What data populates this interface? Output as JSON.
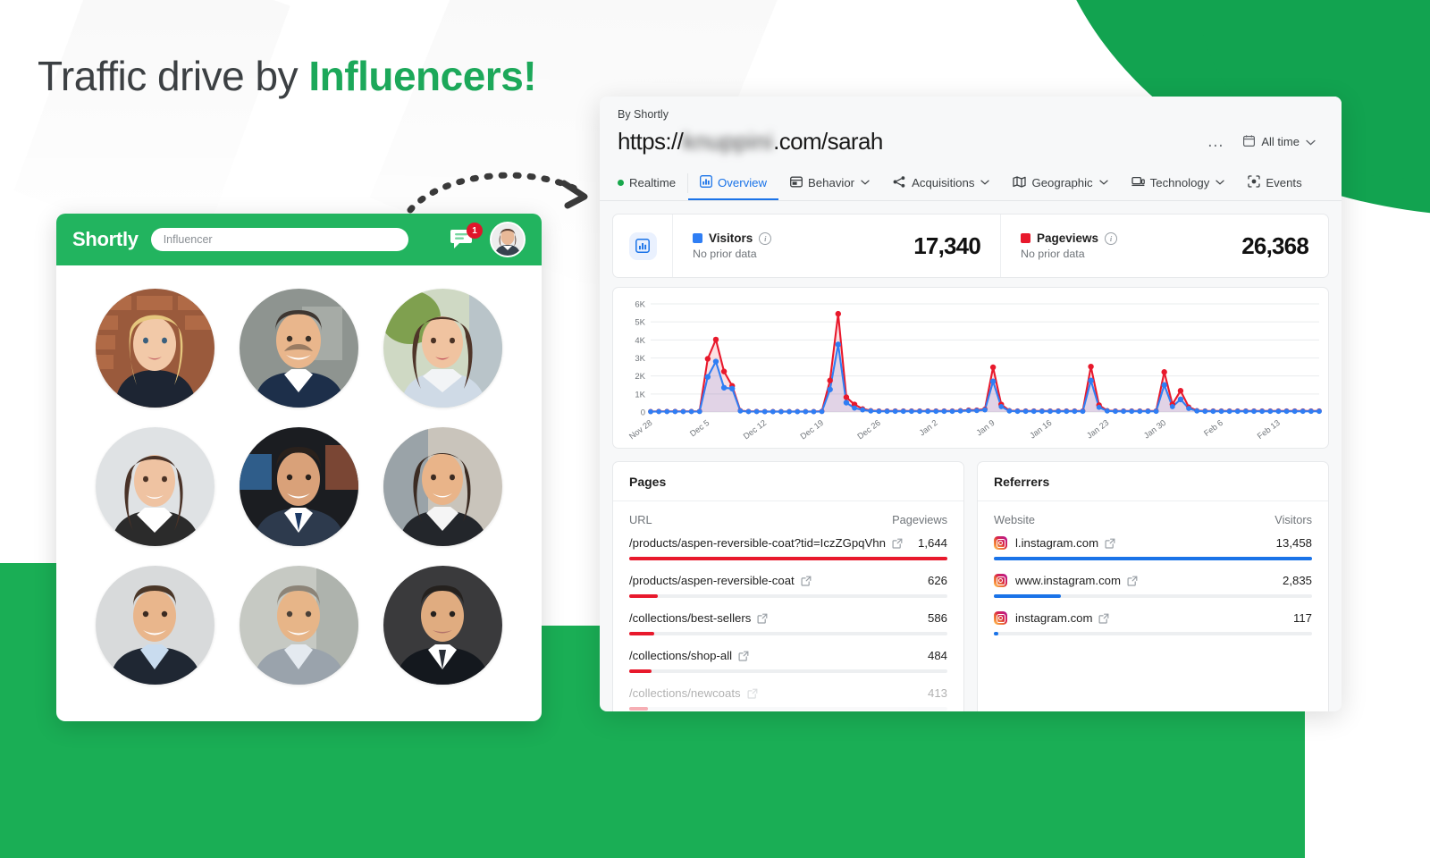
{
  "headline": {
    "text_plain": "Traffic drive by ",
    "text_accent": "Influencers!"
  },
  "colors": {
    "brand_green": "#1CA85A",
    "app_bar_green": "#22B45F",
    "visitors_blue": "#2F7EF4",
    "pageviews_red": "#E8192C",
    "active_tab_blue": "#1A73E8"
  },
  "app": {
    "logo": "Shortly",
    "search_value": "Influencer",
    "search_placeholder": "Influencer",
    "chat_badge": "1",
    "icons": {
      "chat": "chat-icon",
      "avatar": "avatar"
    },
    "influencer_count": 9
  },
  "analytics": {
    "owner_label": "By Shortly",
    "url_prefix": "https://",
    "url_domain_blurred": "knuppini",
    "url_suffix": ".com/sarah",
    "more_menu": "…",
    "date_range": "All time",
    "tabs": [
      {
        "label": "Realtime",
        "icon": "live-dot-icon",
        "active": false,
        "caret": false
      },
      {
        "label": "Overview",
        "icon": "bar-chart-icon",
        "active": true,
        "caret": false
      },
      {
        "label": "Behavior",
        "icon": "window-icon",
        "active": false,
        "caret": true
      },
      {
        "label": "Acquisitions",
        "icon": "branch-icon",
        "active": false,
        "caret": true
      },
      {
        "label": "Geographic",
        "icon": "map-icon",
        "active": false,
        "caret": true
      },
      {
        "label": "Technology",
        "icon": "laptop-icon",
        "active": false,
        "caret": true
      },
      {
        "label": "Events",
        "icon": "target-icon",
        "active": false,
        "caret": false
      }
    ],
    "stats": [
      {
        "label": "Visitors",
        "sub": "No prior data",
        "value": "17,340",
        "color": "#2F7EF4"
      },
      {
        "label": "Pageviews",
        "sub": "No prior data",
        "value": "26,368",
        "color": "#E8192C"
      }
    ],
    "pages": {
      "title": "Pages",
      "col_url": "URL",
      "col_value": "Pageviews",
      "rows": [
        {
          "url": "/products/aspen-reversible-coat?tid=IczZGpqVhn",
          "value": "1,644",
          "pct": 100
        },
        {
          "url": "/products/aspen-reversible-coat",
          "value": "626",
          "pct": 9
        },
        {
          "url": "/collections/best-sellers",
          "value": "586",
          "pct": 8
        },
        {
          "url": "/collections/shop-all",
          "value": "484",
          "pct": 7
        },
        {
          "url": "/collections/newcoats",
          "value": "413",
          "pct": 6
        }
      ]
    },
    "referrers": {
      "title": "Referrers",
      "col_site": "Website",
      "col_value": "Visitors",
      "rows": [
        {
          "site": "l.instagram.com",
          "value": "13,458",
          "pct": 100,
          "icon": "instagram-icon"
        },
        {
          "site": "www.instagram.com",
          "value": "2,835",
          "pct": 21,
          "icon": "instagram-icon"
        },
        {
          "site": "instagram.com",
          "value": "117",
          "pct": 1.5,
          "icon": "instagram-icon"
        }
      ]
    }
  },
  "chart_data": {
    "type": "line",
    "title": "",
    "xlabel": "",
    "ylabel": "",
    "ylim": [
      0,
      6000
    ],
    "yticks": [
      0,
      1000,
      2000,
      3000,
      4000,
      5000,
      6000
    ],
    "ytick_labels": [
      "0",
      "1K",
      "2K",
      "3K",
      "4K",
      "5K",
      "6K"
    ],
    "grid": true,
    "legend_position": "top-panel",
    "xtick_labels": [
      "Nov 28",
      "Dec 5",
      "Dec 12",
      "Dec 19",
      "Dec 26",
      "Jan 2",
      "Jan 9",
      "Jan 16",
      "Jan 23",
      "Jan 30",
      "Feb 6",
      "Feb 13"
    ],
    "xtick_indices": [
      0,
      7,
      14,
      21,
      28,
      35,
      42,
      49,
      56,
      63,
      70,
      77
    ],
    "x": [
      "Nov 28",
      "Nov 29",
      "Nov 30",
      "Dec 1",
      "Dec 2",
      "Dec 3",
      "Dec 4",
      "Dec 5",
      "Dec 6",
      "Dec 7",
      "Dec 8",
      "Dec 9",
      "Dec 10",
      "Dec 11",
      "Dec 12",
      "Dec 13",
      "Dec 14",
      "Dec 15",
      "Dec 16",
      "Dec 17",
      "Dec 18",
      "Dec 19",
      "Dec 20",
      "Dec 21",
      "Dec 22",
      "Dec 23",
      "Dec 24",
      "Dec 25",
      "Dec 26",
      "Dec 27",
      "Dec 28",
      "Dec 29",
      "Dec 30",
      "Dec 31",
      "Jan 1",
      "Jan 2",
      "Jan 3",
      "Jan 4",
      "Jan 5",
      "Jan 6",
      "Jan 7",
      "Jan 8",
      "Jan 9",
      "Jan 10",
      "Jan 11",
      "Jan 12",
      "Jan 13",
      "Jan 14",
      "Jan 15",
      "Jan 16",
      "Jan 17",
      "Jan 18",
      "Jan 19",
      "Jan 20",
      "Jan 21",
      "Jan 22",
      "Jan 23",
      "Jan 24",
      "Jan 25",
      "Jan 26",
      "Jan 27",
      "Jan 28",
      "Jan 29",
      "Jan 30",
      "Jan 31",
      "Feb 1",
      "Feb 2",
      "Feb 3",
      "Feb 4",
      "Feb 5",
      "Feb 6",
      "Feb 7",
      "Feb 8",
      "Feb 9",
      "Feb 10",
      "Feb 11",
      "Feb 12",
      "Feb 13",
      "Feb 14",
      "Feb 15",
      "Feb 16",
      "Feb 17"
    ],
    "series": [
      {
        "name": "Visitors",
        "color": "#2F7EF4",
        "values": [
          20,
          25,
          25,
          25,
          25,
          25,
          30,
          1950,
          2800,
          1350,
          1300,
          60,
          25,
          25,
          20,
          20,
          20,
          20,
          20,
          20,
          20,
          30,
          1250,
          3750,
          520,
          220,
          120,
          60,
          40,
          40,
          40,
          40,
          40,
          40,
          40,
          40,
          40,
          40,
          60,
          80,
          80,
          120,
          1700,
          300,
          60,
          40,
          40,
          40,
          40,
          40,
          40,
          40,
          40,
          40,
          1750,
          260,
          60,
          40,
          40,
          40,
          40,
          40,
          40,
          1500,
          300,
          700,
          200,
          60,
          40,
          40,
          40,
          40,
          40,
          40,
          40,
          40,
          40,
          40,
          40,
          40,
          40,
          40,
          40
        ]
      },
      {
        "name": "Pageviews",
        "color": "#E8192C",
        "values": [
          30,
          35,
          35,
          35,
          35,
          35,
          40,
          2950,
          4020,
          2250,
          1450,
          80,
          35,
          35,
          30,
          30,
          30,
          30,
          30,
          30,
          30,
          40,
          1750,
          5450,
          820,
          420,
          180,
          80,
          60,
          60,
          60,
          60,
          60,
          60,
          60,
          60,
          60,
          60,
          80,
          110,
          110,
          160,
          2480,
          420,
          80,
          60,
          60,
          60,
          60,
          60,
          60,
          60,
          60,
          60,
          2520,
          380,
          80,
          60,
          60,
          60,
          60,
          60,
          60,
          2220,
          430,
          1180,
          280,
          80,
          60,
          60,
          60,
          60,
          60,
          60,
          60,
          60,
          60,
          60,
          60,
          60,
          60,
          60,
          60
        ]
      }
    ]
  }
}
